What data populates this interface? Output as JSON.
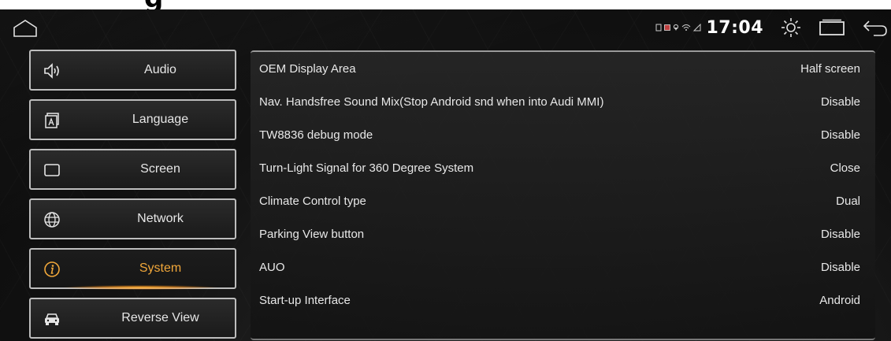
{
  "statusbar": {
    "time": "17:04",
    "icons": [
      "home-outline-icon",
      "sd-card-icon",
      "notification-icon",
      "location-icon",
      "wifi-icon",
      "signal-icon",
      "brightness-icon",
      "recent-apps-icon",
      "back-icon"
    ]
  },
  "sidebar": {
    "items": [
      {
        "label": "Audio",
        "icon": "speaker-icon",
        "active": false
      },
      {
        "label": "Language",
        "icon": "language-icon",
        "active": false
      },
      {
        "label": "Screen",
        "icon": "screen-icon",
        "active": false
      },
      {
        "label": "Network",
        "icon": "globe-icon",
        "active": false
      },
      {
        "label": "System",
        "icon": "info-icon",
        "active": true
      },
      {
        "label": "Reverse View",
        "icon": "car-icon",
        "active": false
      }
    ]
  },
  "settings": {
    "rows": [
      {
        "name": "OEM Display Area",
        "value": "Half screen"
      },
      {
        "name": "Nav. Handsfree Sound Mix(Stop Android snd when into Audi MMI)",
        "value": "Disable"
      },
      {
        "name": "TW8836 debug mode",
        "value": "Disable"
      },
      {
        "name": "Turn-Light Signal for 360 Degree System",
        "value": "Close"
      },
      {
        "name": "Climate Control type",
        "value": "Dual"
      },
      {
        "name": "Parking View button",
        "value": "Disable"
      },
      {
        "name": "AUO",
        "value": "Disable"
      },
      {
        "name": "Start-up Interface",
        "value": "Android"
      }
    ]
  },
  "colors": {
    "accent": "#f0a73a",
    "text": "#e8e8e8",
    "border": "#bdbdbd",
    "background": "#121212"
  }
}
